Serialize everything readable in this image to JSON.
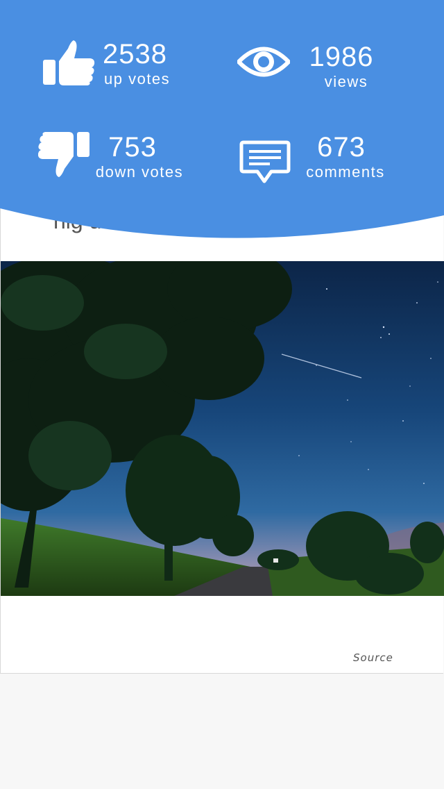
{
  "colors": {
    "banner": "#4a8fe2",
    "banner_text": "#ffffff",
    "card_background": "#ffffff",
    "page_background": "#f7f7f7"
  },
  "stats": {
    "up_votes": {
      "count": "2538",
      "label": "up votes",
      "icon": "thumbs-up-icon"
    },
    "views": {
      "count": "1986",
      "label": "views",
      "icon": "eye-icon"
    },
    "down_votes": {
      "count": "753",
      "label": "down votes",
      "icon": "thumbs-down-icon"
    },
    "comments": {
      "count": "673",
      "label": "comments",
      "icon": "comment-bubble-icon"
    }
  },
  "post": {
    "title_fragment": "nig                                               u...",
    "image_description_icon": "night-sky-photo",
    "source_label": "Source"
  }
}
